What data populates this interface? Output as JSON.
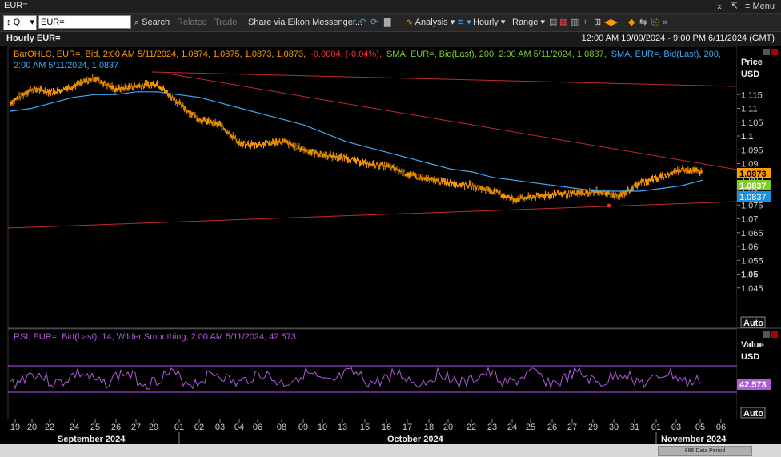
{
  "window": {
    "title": "EUR=",
    "menu_label": "Menu",
    "pin_icon": "pin-icon",
    "popout_icon": "popout-icon"
  },
  "toolbar": {
    "quote_label": "Q",
    "symbol_value": "EUR=",
    "search_label": "Search",
    "related_label": "Related",
    "trade_label": "Trade",
    "share_label": "Share via Eikon Messenger...",
    "analysis_label": "Analysis",
    "hourly_label": "Hourly",
    "range_label": "Range"
  },
  "header": {
    "title": "Hourly EUR=",
    "date_range": "12:00 AM 19/09/2024 - 9:00 PM 6/11/2024 (GMT)"
  },
  "legend": {
    "bar_ohlc": "BarOHLC, EUR=, Bid, 2:00 AM 5/11/2024, 1.0874, 1.0875, 1.0873, 1.0873,",
    "bar_change": "-0.0004, (-0.04%),",
    "sma_green": "SMA, EUR=, Bid(Last),  200, 2:00 AM 5/11/2024, 1.0837,",
    "sma_blue": "SMA, EUR=, Bid(Last),  200,",
    "sma_blue_2": "2:00 AM 5/11/2024, 1.0837"
  },
  "price_axis": {
    "title": "Price",
    "unit": "USD",
    "auto_label": "Auto",
    "ticks": [
      "1.115",
      "1.11",
      "1.105",
      "1.1",
      "1.095",
      "1.09",
      "1.085",
      "1.08",
      "1.075",
      "1.07",
      "1.065",
      "1.06",
      "1.055",
      "1.05",
      "1.045"
    ],
    "last_price": "1.0873",
    "sma_green_value": "1.0837",
    "sma_blue_value": "1.0837"
  },
  "rsi": {
    "legend": "RSI, EUR=, Bid(Last),  14, Wilder Smoothing, 2:00 AM 5/11/2024, 42.573",
    "axis_title": "Value",
    "axis_unit": "USD",
    "last_value": "42.573",
    "auto_label": "Auto"
  },
  "time_axis": {
    "day_ticks": [
      "19",
      "20",
      "22",
      "24",
      "25",
      "26",
      "27",
      "29",
      "01",
      "02",
      "03",
      "04",
      "06",
      "08",
      "09",
      "10",
      "13",
      "15",
      "16",
      "17",
      "18",
      "20",
      "22",
      "23",
      "24",
      "25",
      "26",
      "27",
      "29",
      "30",
      "31",
      "01",
      "03",
      "05",
      "06"
    ],
    "months": [
      "September 2024",
      "October 2024",
      "November 2024"
    ]
  },
  "scrollbar": {
    "label": "866 Data Period"
  },
  "colors": {
    "price": "#ff9a00",
    "sma_blue": "#3fa9f5",
    "sma_green": "#7ccd2a",
    "trend": "#c0282d",
    "rsi": "#b05ad8",
    "rsi_band": "#9a3cd0"
  },
  "chart_data": [
    {
      "type": "line",
      "title": "Hourly EUR=",
      "ylabel": "Price USD",
      "ylim": [
        1.041,
        1.123
      ],
      "x": [
        "19 Sep",
        "20 Sep",
        "22 Sep",
        "24 Sep",
        "25 Sep",
        "26 Sep",
        "27 Sep",
        "29 Sep",
        "01 Oct",
        "02 Oct",
        "03 Oct",
        "04 Oct",
        "06 Oct",
        "08 Oct",
        "09 Oct",
        "10 Oct",
        "13 Oct",
        "15 Oct",
        "16 Oct",
        "17 Oct",
        "18 Oct",
        "20 Oct",
        "22 Oct",
        "23 Oct",
        "24 Oct",
        "25 Oct",
        "26 Oct",
        "27 Oct",
        "29 Oct",
        "30 Oct",
        "31 Oct",
        "01 Nov",
        "03 Nov",
        "05 Nov"
      ],
      "series": [
        {
          "name": "BarOHLC, EUR=, Bid",
          "values": [
            1.112,
            1.117,
            1.116,
            1.118,
            1.121,
            1.117,
            1.118,
            1.119,
            1.112,
            1.106,
            1.104,
            1.097,
            1.097,
            1.098,
            1.095,
            1.093,
            1.092,
            1.09,
            1.089,
            1.086,
            1.084,
            1.083,
            1.082,
            1.08,
            1.077,
            1.078,
            1.079,
            1.079,
            1.08,
            1.078,
            1.083,
            1.085,
            1.088,
            1.087
          ]
        },
        {
          "name": "SMA, EUR=, Bid(Last), 200",
          "values": [
            1.109,
            1.11,
            1.112,
            1.114,
            1.115,
            1.115,
            1.116,
            1.116,
            1.115,
            1.114,
            1.112,
            1.11,
            1.108,
            1.106,
            1.104,
            1.101,
            1.098,
            1.096,
            1.094,
            1.092,
            1.09,
            1.088,
            1.087,
            1.085,
            1.084,
            1.083,
            1.082,
            1.081,
            1.08,
            1.08,
            1.08,
            1.081,
            1.082,
            1.084
          ]
        }
      ]
    },
    {
      "type": "line",
      "title": "RSI, EUR=, Bid(Last), 14, Wilder Smoothing",
      "ylabel": "Value USD",
      "series": [
        {
          "name": "RSI 14",
          "last_value": 42.573,
          "upper_band": 70,
          "lower_band": 30
        }
      ]
    }
  ]
}
